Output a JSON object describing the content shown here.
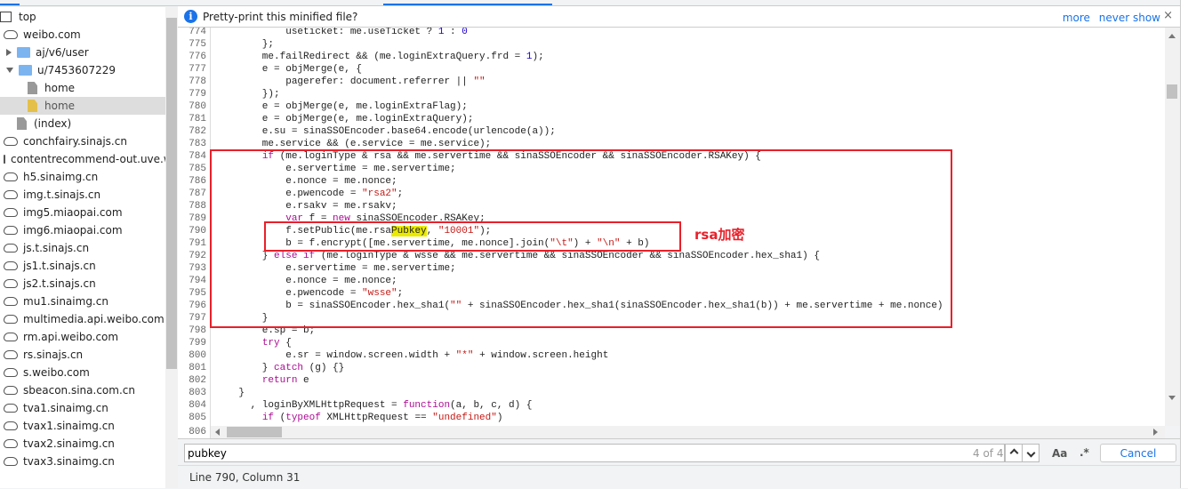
{
  "sidebar": {
    "items": [
      {
        "label": "top",
        "type": "frame",
        "indent": 0
      },
      {
        "label": "weibo.com",
        "type": "cloud",
        "indent": 0
      },
      {
        "label": "aj/v6/user",
        "type": "folder",
        "indent": 1,
        "arrow": "right"
      },
      {
        "label": "u/7453607229",
        "type": "folder",
        "indent": 1,
        "arrow": "down"
      },
      {
        "label": "home",
        "type": "file",
        "indent": 2
      },
      {
        "label": "home",
        "type": "file-yellow",
        "indent": 2,
        "selected": true
      },
      {
        "label": "(index)",
        "type": "file",
        "indent": 1
      },
      {
        "label": "conchfairy.sinajs.cn",
        "type": "cloud",
        "indent": 0
      },
      {
        "label": "contentrecommend-out.uve.weibo.com",
        "type": "cloud",
        "indent": 0
      },
      {
        "label": "h5.sinaimg.cn",
        "type": "cloud",
        "indent": 0
      },
      {
        "label": "img.t.sinajs.cn",
        "type": "cloud",
        "indent": 0
      },
      {
        "label": "img5.miaopai.com",
        "type": "cloud",
        "indent": 0
      },
      {
        "label": "img6.miaopai.com",
        "type": "cloud",
        "indent": 0
      },
      {
        "label": "js.t.sinajs.cn",
        "type": "cloud",
        "indent": 0
      },
      {
        "label": "js1.t.sinajs.cn",
        "type": "cloud",
        "indent": 0
      },
      {
        "label": "js2.t.sinajs.cn",
        "type": "cloud",
        "indent": 0
      },
      {
        "label": "mu1.sinaimg.cn",
        "type": "cloud",
        "indent": 0
      },
      {
        "label": "multimedia.api.weibo.com",
        "type": "cloud",
        "indent": 0
      },
      {
        "label": "rm.api.weibo.com",
        "type": "cloud",
        "indent": 0
      },
      {
        "label": "rs.sinajs.cn",
        "type": "cloud",
        "indent": 0
      },
      {
        "label": "s.weibo.com",
        "type": "cloud",
        "indent": 0
      },
      {
        "label": "sbeacon.sina.com.cn",
        "type": "cloud",
        "indent": 0
      },
      {
        "label": "tva1.sinaimg.cn",
        "type": "cloud",
        "indent": 0
      },
      {
        "label": "tvax1.sinaimg.cn",
        "type": "cloud",
        "indent": 0
      },
      {
        "label": "tvax2.sinaimg.cn",
        "type": "cloud",
        "indent": 0
      },
      {
        "label": "tvax3.sinaimg.cn",
        "type": "cloud",
        "indent": 0
      }
    ]
  },
  "infobar": {
    "icon": "info-icon",
    "message": "Pretty-print this minified file?",
    "more": "more",
    "never_show": "never show",
    "close": "×"
  },
  "editor": {
    "first_line": 774,
    "highlight_term": "Pubkey",
    "lines": [
      "            useticket: me.useTicket ? 1 : 0",
      "        };",
      "        me.failRedirect && (me.loginExtraQuery.frd = 1);",
      "        e = objMerge(e, {",
      "            pagerefer: document.referrer || \"\"",
      "        });",
      "        e = objMerge(e, me.loginExtraFlag);",
      "        e = objMerge(e, me.loginExtraQuery);",
      "        e.su = sinaSSOEncoder.base64.encode(urlencode(a));",
      "        me.service && (e.service = me.service);",
      "        if (me.loginType & rsa && me.servertime && sinaSSOEncoder && sinaSSOEncoder.RSAKey) {",
      "            e.servertime = me.servertime;",
      "            e.nonce = me.nonce;",
      "            e.pwencode = \"rsa2\";",
      "            e.rsakv = me.rsakv;",
      "            var f = new sinaSSOEncoder.RSAKey;",
      "            f.setPublic(me.rsaPubkey, \"10001\");",
      "            b = f.encrypt([me.servertime, me.nonce].join(\"\\t\") + \"\\n\" + b)",
      "        } else if (me.loginType & wsse && me.servertime && sinaSSOEncoder && sinaSSOEncoder.hex_sha1) {",
      "            e.servertime = me.servertime;",
      "            e.nonce = me.nonce;",
      "            e.pwencode = \"wsse\";",
      "            b = sinaSSOEncoder.hex_sha1(\"\" + sinaSSOEncoder.hex_sha1(sinaSSOEncoder.hex_sha1(b)) + me.servertime + me.nonce)",
      "        }",
      "        e.sp = b;",
      "        try {",
      "            e.sr = window.screen.width + \"*\" + window.screen.height",
      "        } catch (g) {}",
      "        return e",
      "    }",
      "      , loginByXMLHttpRequest = function(a, b, c, d) {",
      "        if (typeof XMLHttpRequest == \"undefined\")"
    ],
    "last_visible_line": "806"
  },
  "annotation": {
    "label": "rsa加密",
    "color": "#e8202a"
  },
  "search": {
    "value": "pubkey",
    "match_count": "4 of 4",
    "prev": "^",
    "next": "v",
    "match_case": "Aa",
    "regex": ".*",
    "cancel": "Cancel"
  },
  "status": {
    "position": "Line 790, Column 31"
  },
  "colors": {
    "accent": "#1a73e8",
    "keyword": "#aa0d91",
    "string": "#c41a16",
    "number": "#1c00cf",
    "search_highlight": "#eaea00"
  }
}
